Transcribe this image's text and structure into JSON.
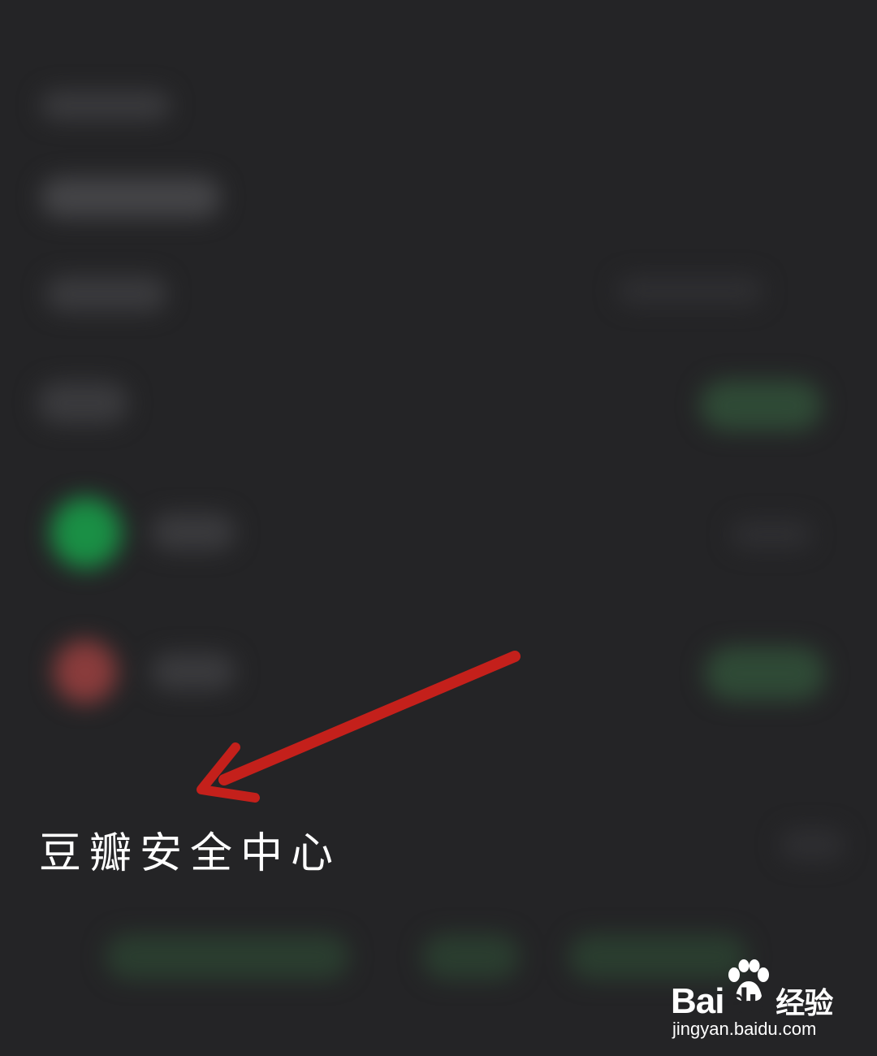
{
  "annotation": {
    "label": "豆瓣安全中心",
    "arrow_color": "#c4201b"
  },
  "watermark": {
    "brand_part1": "Bai",
    "brand_part2": "du",
    "brand_part3": "经验",
    "url": "jingyan.baidu.com"
  },
  "colors": {
    "background": "#242426",
    "status_green": "#1a8f45",
    "status_red": "#8a3c3c"
  }
}
